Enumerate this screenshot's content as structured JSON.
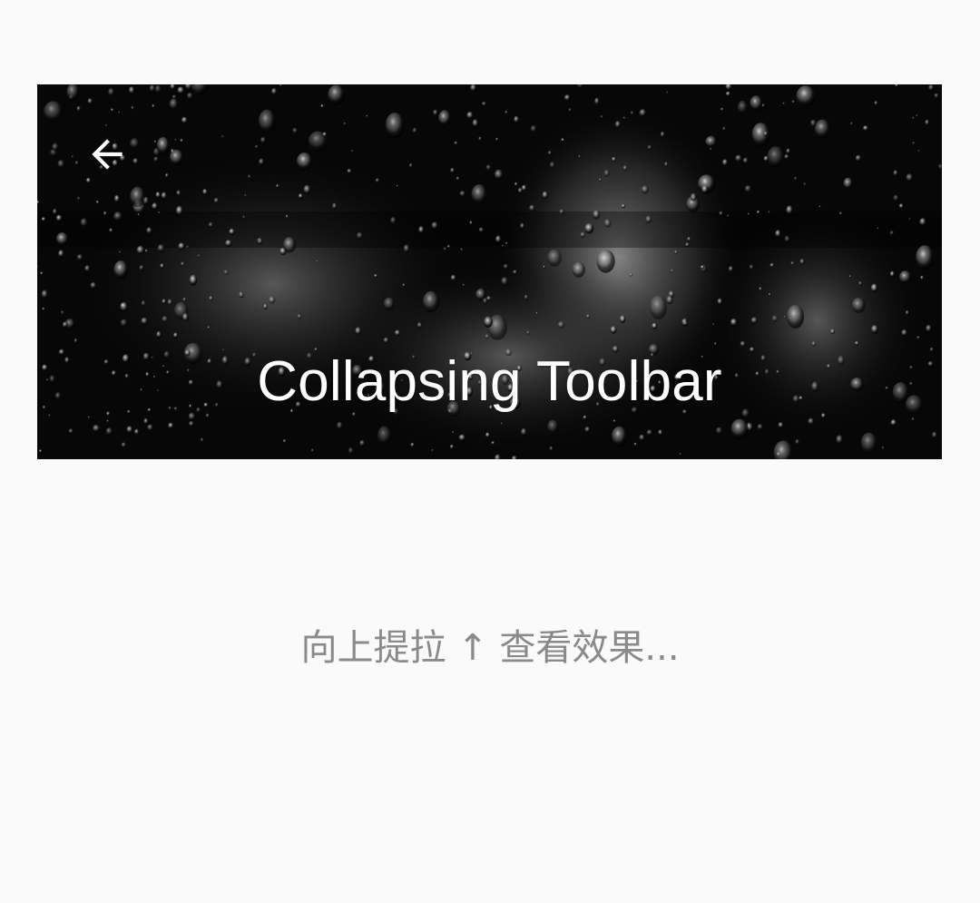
{
  "toolbar": {
    "title": "Collapsing Toolbar",
    "back_icon": "arrow-back-icon",
    "header_image": "raindrops-on-glass-photo"
  },
  "content": {
    "hint_text": "向上提拉 ↑ 查看效果..."
  },
  "colors": {
    "background": "#fafafa",
    "title_text": "#ffffff",
    "hint_text": "#8a8a8a"
  }
}
